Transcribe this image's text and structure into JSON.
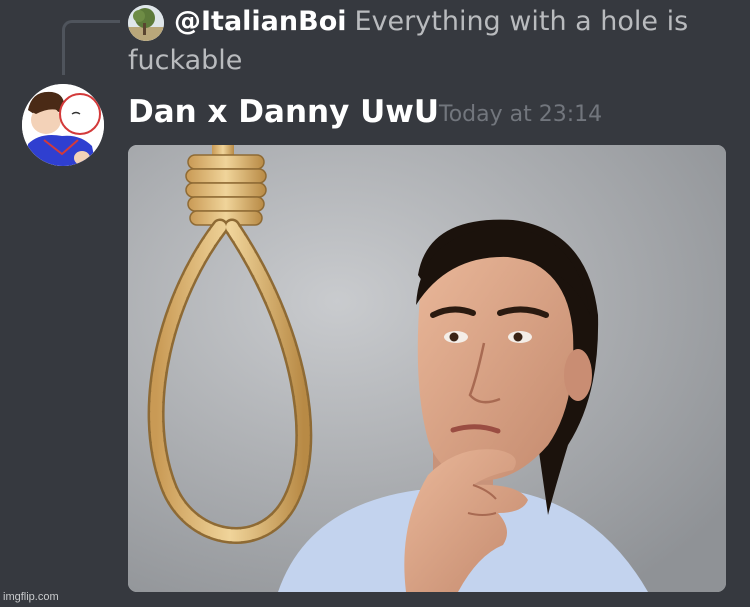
{
  "reply": {
    "username": "@ItalianBoi",
    "text_line1": "Everything with a hole is",
    "text_line2": "fuckable",
    "avatar_icon": "tree-landscape-avatar"
  },
  "message": {
    "author": "Dan x Danny UwU",
    "timestamp": "Today at 23:14",
    "avatar_icon": "cartoon-character-avatar",
    "attachment_icon": "noose-and-thinking-man-image"
  },
  "watermark": "imgflip.com",
  "colors": {
    "background": "#36393f",
    "username": "#ffffff",
    "text_muted": "#b9bbbe",
    "timestamp": "#72767d",
    "connector": "#4f545c"
  }
}
